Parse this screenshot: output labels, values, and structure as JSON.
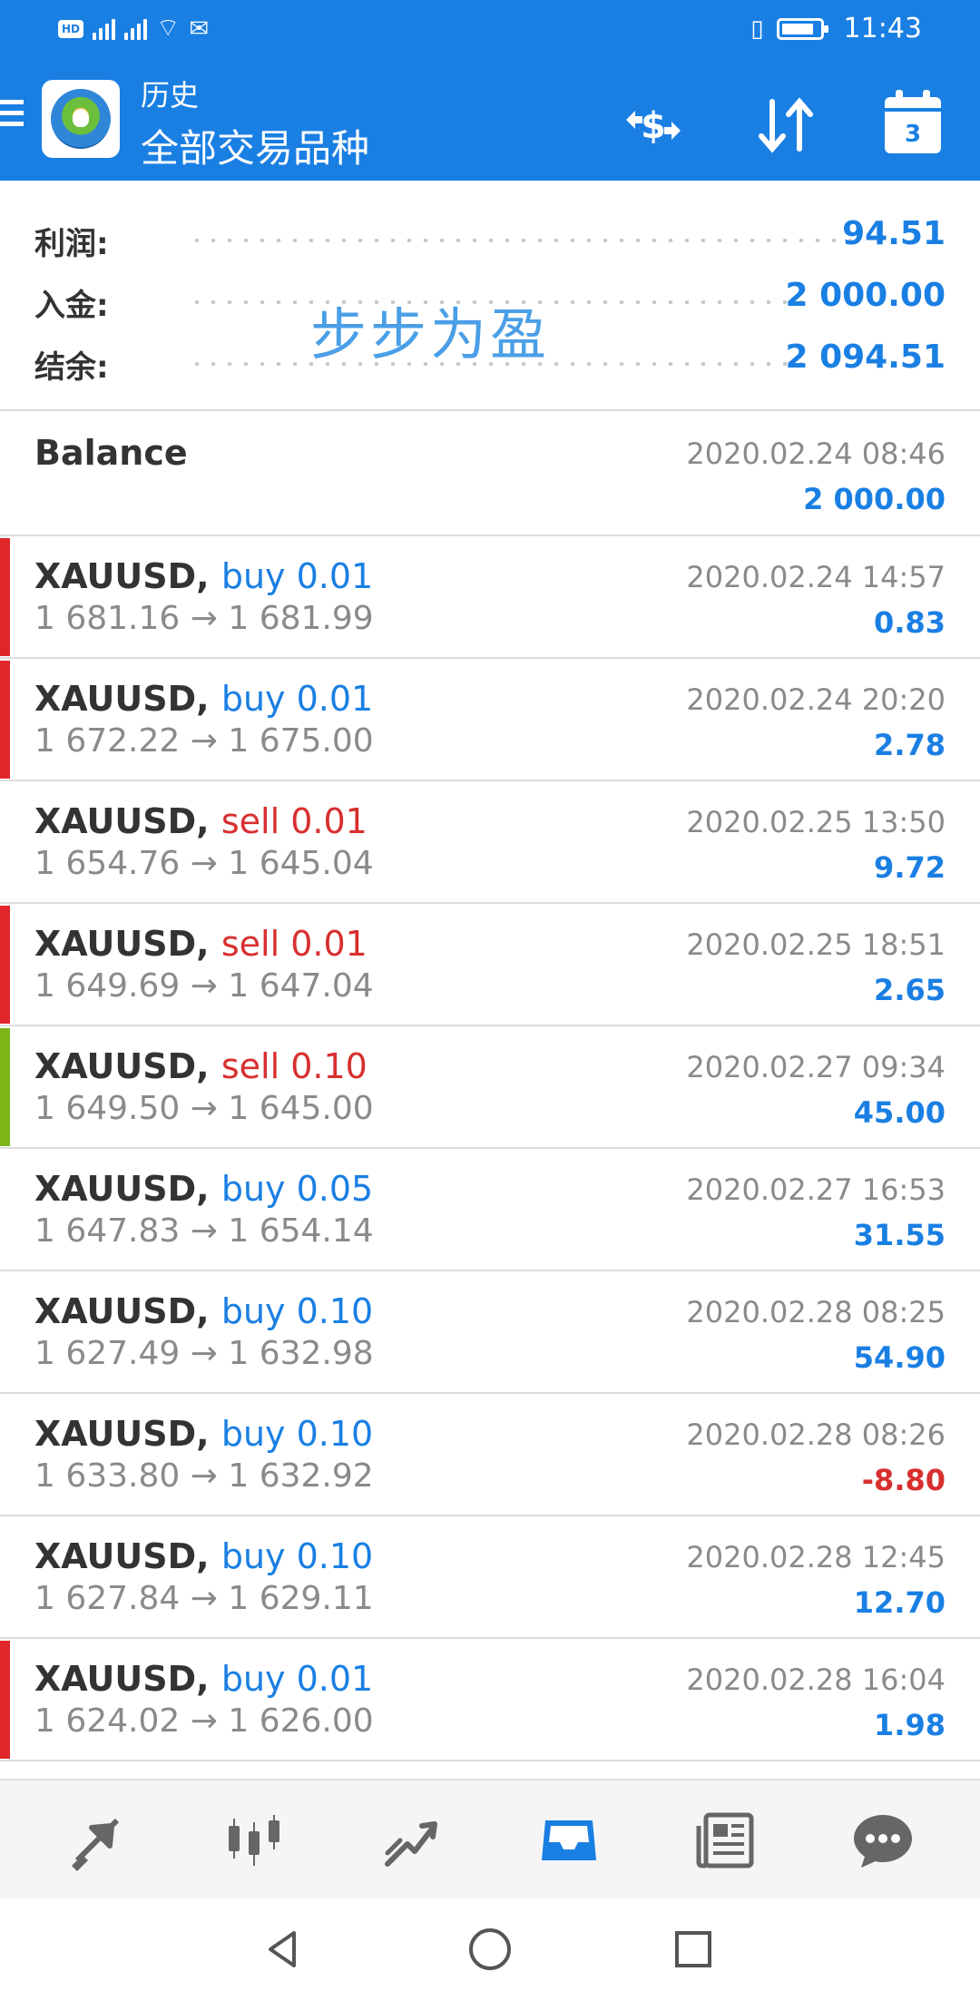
{
  "statusbar": {
    "left": "HD",
    "time": "11:43"
  },
  "header": {
    "title_small": "历史",
    "title_big": "全部交易品种",
    "calendar_day": "3"
  },
  "summary": [
    {
      "label": "利润:",
      "value": "94.51"
    },
    {
      "label": "入金:",
      "value": "2 000.00"
    },
    {
      "label": "结余:",
      "value": "2 094.51"
    }
  ],
  "watermark": "步步为盈",
  "balance": {
    "label": "Balance",
    "time": "2020.02.24 08:46",
    "value": "2 000.00"
  },
  "deals": [
    {
      "symbol": "XAUUSD,",
      "side": "buy 0.01",
      "prices": "1 681.16 → 1 681.99",
      "time": "2020.02.24 14:57",
      "profit": "0.83",
      "marker": "red"
    },
    {
      "symbol": "XAUUSD,",
      "side": "buy 0.01",
      "prices": "1 672.22 → 1 675.00",
      "time": "2020.02.24 20:20",
      "profit": "2.78",
      "marker": "red"
    },
    {
      "symbol": "XAUUSD,",
      "side": "sell 0.01",
      "prices": "1 654.76 → 1 645.04",
      "time": "2020.02.25 13:50",
      "profit": "9.72",
      "marker": "none"
    },
    {
      "symbol": "XAUUSD,",
      "side": "sell 0.01",
      "prices": "1 649.69 → 1 647.04",
      "time": "2020.02.25 18:51",
      "profit": "2.65",
      "marker": "red"
    },
    {
      "symbol": "XAUUSD,",
      "side": "sell 0.10",
      "prices": "1 649.50 → 1 645.00",
      "time": "2020.02.27 09:34",
      "profit": "45.00",
      "marker": "green"
    },
    {
      "symbol": "XAUUSD,",
      "side": "buy 0.05",
      "prices": "1 647.83 → 1 654.14",
      "time": "2020.02.27 16:53",
      "profit": "31.55",
      "marker": "none"
    },
    {
      "symbol": "XAUUSD,",
      "side": "buy 0.10",
      "prices": "1 627.49 → 1 632.98",
      "time": "2020.02.28 08:25",
      "profit": "54.90",
      "marker": "none"
    },
    {
      "symbol": "XAUUSD,",
      "side": "buy 0.10",
      "prices": "1 633.80 → 1 632.92",
      "time": "2020.02.28 08:26",
      "profit": "-8.80",
      "marker": "none"
    },
    {
      "symbol": "XAUUSD,",
      "side": "buy 0.10",
      "prices": "1 627.84 → 1 629.11",
      "time": "2020.02.28 12:45",
      "profit": "12.70",
      "marker": "none"
    },
    {
      "symbol": "XAUUSD,",
      "side": "buy 0.01",
      "prices": "1 624.02 → 1 626.00",
      "time": "2020.02.28 16:04",
      "profit": "1.98",
      "marker": "red"
    }
  ],
  "colors": {
    "accent": "#1a7fe3",
    "loss": "#d82f2f",
    "marker_red": "#e0262b",
    "marker_green": "#7cb518",
    "text_grey": "#8a8a8a"
  },
  "bottom_nav": [
    {
      "name": "quotes-icon",
      "active": false
    },
    {
      "name": "chart-icon",
      "active": false
    },
    {
      "name": "trade-icon",
      "active": false
    },
    {
      "name": "history-icon",
      "active": true
    },
    {
      "name": "news-icon",
      "active": false
    },
    {
      "name": "chat-icon",
      "active": false
    }
  ]
}
